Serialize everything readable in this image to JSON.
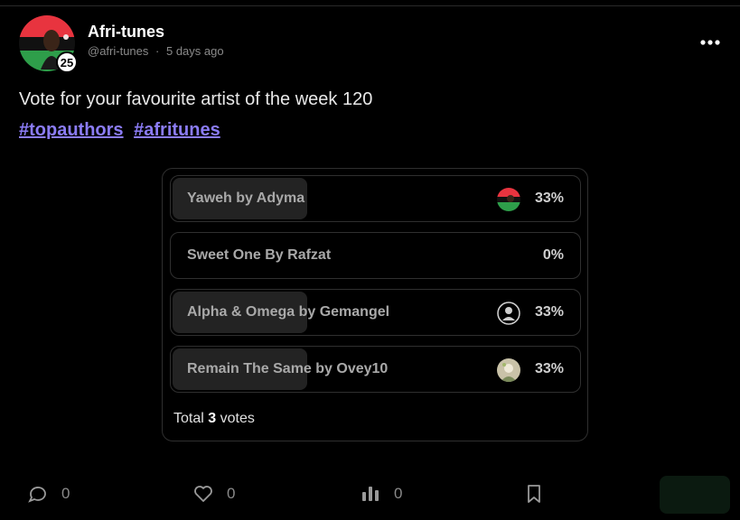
{
  "post": {
    "author_name": "Afri-tunes",
    "handle": "@afri-tunes",
    "separator": "·",
    "time_ago": "5 days ago",
    "level": "25",
    "text": "Vote for your favourite artist of the week 120",
    "tags": [
      "#topauthors",
      "#afritunes"
    ]
  },
  "poll": {
    "options": [
      {
        "label": "Yaweh by Adyma",
        "percent_text": "33%",
        "percent": 33,
        "voter_icon": "red-green-flag-avatar"
      },
      {
        "label": "Sweet One By Rafzat",
        "percent_text": "0%",
        "percent": 0,
        "voter_icon": ""
      },
      {
        "label": "Alpha & Omega by Gemangel",
        "percent_text": "33%",
        "percent": 33,
        "voter_icon": "user-icon"
      },
      {
        "label": "Remain The Same by Ovey10",
        "percent_text": "33%",
        "percent": 33,
        "voter_icon": "photo-avatar"
      }
    ],
    "total_prefix": "Total",
    "total_count": "3",
    "total_suffix": "votes"
  },
  "actions": {
    "comments": "0",
    "likes": "0",
    "views": "0"
  },
  "colors": {
    "tag": "#8b7cf6",
    "flag_red": "#e8343f",
    "flag_green": "#2e9e4a"
  }
}
